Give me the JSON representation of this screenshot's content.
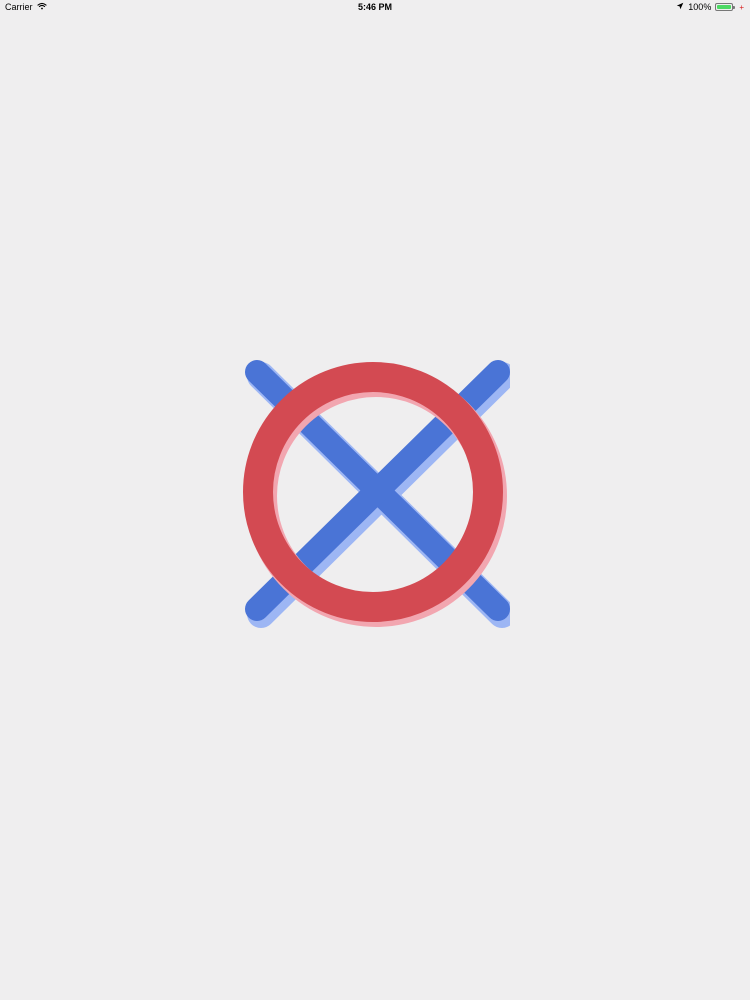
{
  "status_bar": {
    "carrier": "Carrier",
    "time": "5:46 PM",
    "battery_text": "100%",
    "battery_level": 1,
    "icons": {
      "wifi": "wifi-icon",
      "location": "location-arrow-icon",
      "charging": "charging-bolt-icon"
    }
  },
  "logo": {
    "x_color": "#4a74d6",
    "o_color": "#d34a52",
    "shadow_blue": "#9db6f4",
    "shadow_red": "#f2a6b0"
  }
}
